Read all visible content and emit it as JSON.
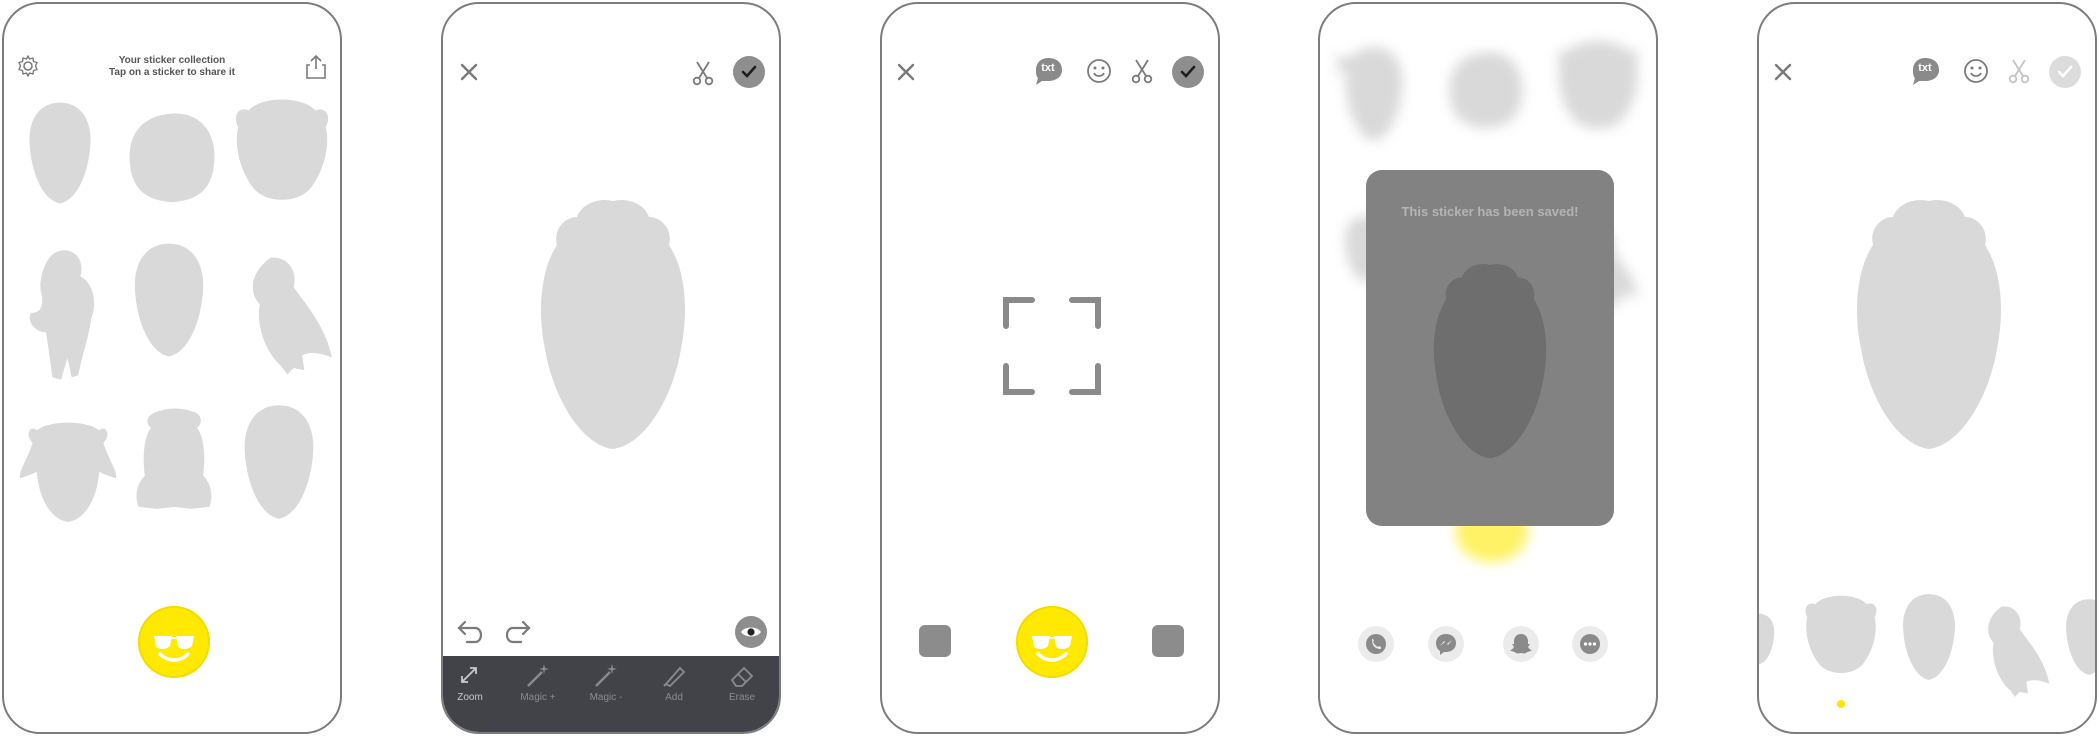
{
  "colors": {
    "accent": "#ffe900",
    "silhouette": "#d9d9d9",
    "toolbar": "#424348",
    "icon": "#8b8b8b"
  },
  "screen1": {
    "title": "Your sticker collection",
    "subtitle": "Tap on a sticker to share it",
    "icons": [
      "gear-icon",
      "share-icon",
      "sunglasses-emoji-icon"
    ]
  },
  "screen2": {
    "icons": [
      "close-icon",
      "scissors-icon",
      "check-icon",
      "undo-icon",
      "redo-icon",
      "eye-icon"
    ],
    "tools": [
      {
        "label": "Zoom"
      },
      {
        "label": "Magic +"
      },
      {
        "label": "Magic -"
      },
      {
        "label": "Add"
      },
      {
        "label": "Erase"
      }
    ]
  },
  "screen3": {
    "txt_label": "txt",
    "icons": [
      "close-icon",
      "txt-icon",
      "smiley-icon",
      "scissors-icon",
      "check-icon",
      "focus-frame-icon",
      "sunglasses-emoji-icon"
    ]
  },
  "screen4": {
    "dialog_message": "This sticker has been saved!",
    "share_targets": [
      "phone-icon",
      "messenger-icon",
      "snapchat-icon",
      "more-icon"
    ]
  },
  "screen5": {
    "txt_label": "txt",
    "icons": [
      "close-icon",
      "txt-icon",
      "smiley-icon",
      "scissors-icon",
      "check-icon"
    ]
  }
}
